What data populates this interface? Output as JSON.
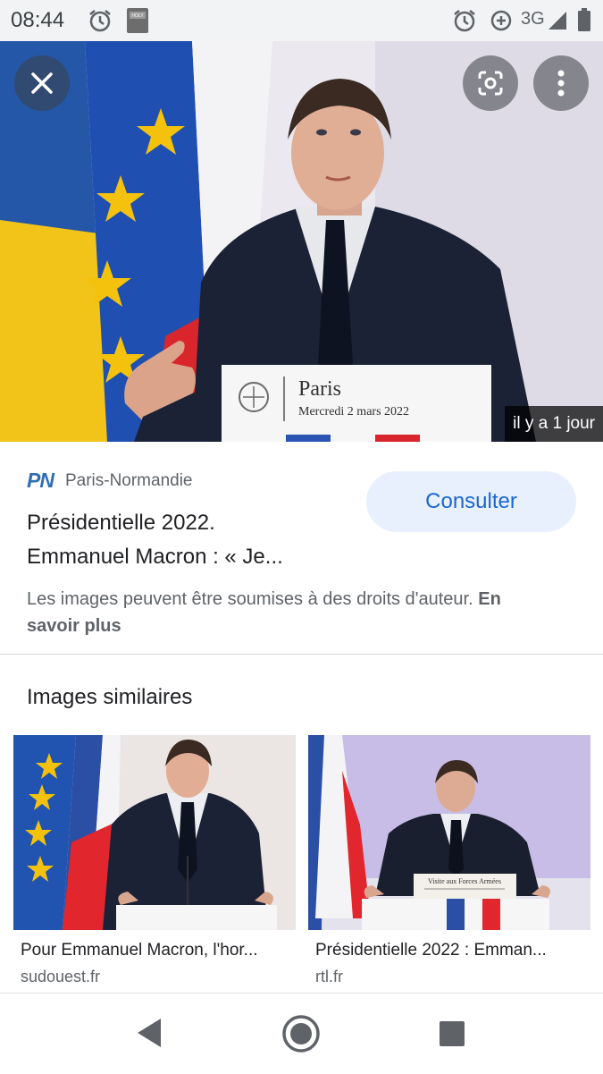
{
  "status_bar": {
    "time": "08:44",
    "network": "3G",
    "icons": [
      "alarm-icon",
      "bible-app-icon",
      "alarm-icon",
      "data-saver-icon",
      "signal-icon",
      "battery-icon"
    ]
  },
  "hero": {
    "timestamp": "il y a 1 jour",
    "podium_city": "Paris",
    "podium_date": "Mercredi 2 mars 2022",
    "close_icon": "close-icon",
    "lens_icon": "lens-icon",
    "more_icon": "more-vert-icon"
  },
  "result": {
    "source_logo": "PN",
    "source_name": "Paris-Normandie",
    "title_line1": "Présidentielle 2022.",
    "title_line2": "Emmanuel Macron : « Je...",
    "consult_label": "Consulter",
    "rights_text": "Les images peuvent être soumises à des droits d'auteur.",
    "rights_link": "En savoir plus"
  },
  "similar": {
    "heading": "Images similaires",
    "items": [
      {
        "title": "Pour Emmanuel Macron, l'hor...",
        "source": "sudouest.fr"
      },
      {
        "title": "Présidentielle 2022 : Emman...",
        "source": "rtl.fr",
        "podium_text": "Visite aux Forces Armées"
      }
    ]
  },
  "nav": {
    "back": "back-icon",
    "home": "home-icon",
    "recents": "recents-icon"
  },
  "colors": {
    "accent": "#1967d2",
    "button_bg": "#e8f0fe",
    "status_bg": "#f1f3f4"
  }
}
